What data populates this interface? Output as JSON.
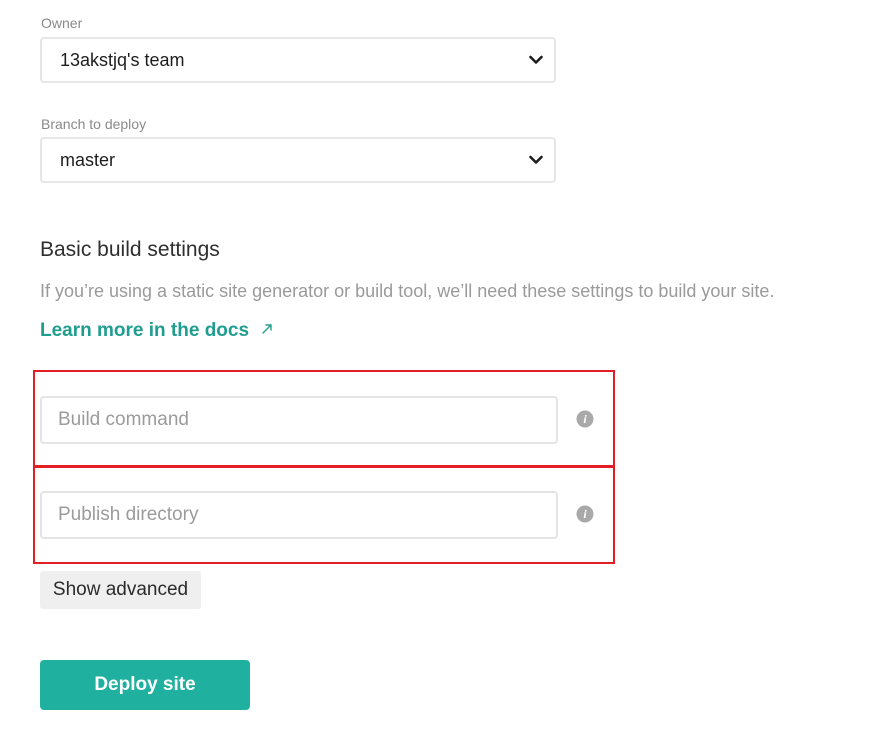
{
  "owner": {
    "label": "Owner",
    "selected": "13akstjq's team",
    "icon": "chevron-down-icon"
  },
  "branch": {
    "label": "Branch to deploy",
    "selected": "master",
    "icon": "chevron-down-icon"
  },
  "build_settings": {
    "title": "Basic build settings",
    "description": "If you’re using a static site generator or build tool, we’ll need these settings to build your site.",
    "docs_link": "Learn more in the docs",
    "docs_link_icon": "external-arrow-icon",
    "build_command": {
      "placeholder": "Build command",
      "value": "",
      "icon": "info-icon"
    },
    "publish_directory": {
      "placeholder": "Publish directory",
      "value": "",
      "icon": "info-icon"
    }
  },
  "buttons": {
    "show_advanced": "Show advanced",
    "deploy": "Deploy site"
  },
  "colors": {
    "accent": "#20b0a0",
    "link": "#1f9d8f",
    "highlight_frame": "#e31e24"
  }
}
